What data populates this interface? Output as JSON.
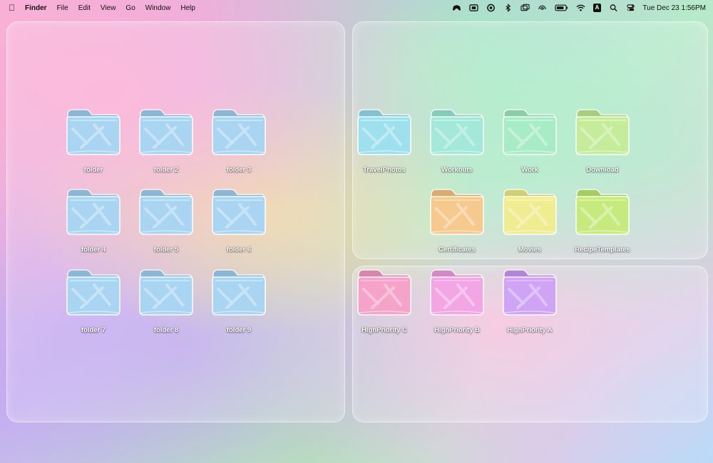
{
  "menubar": {
    "app": "Finder",
    "items": [
      "File",
      "Edit",
      "View",
      "Go",
      "Window",
      "Help"
    ],
    "status_icons": [
      "game-controller-icon",
      "display-icon",
      "chatgpt-icon",
      "bluetooth-icon",
      "screen-mirror-icon",
      "airdrop-icon",
      "battery-icon",
      "wifi-icon"
    ],
    "input_badge": "A",
    "clock": "Tue Dec 23  1:56PM"
  },
  "folders": [
    {
      "name": "folder",
      "color": "#a9d4f2"
    },
    {
      "name": "folder 2",
      "color": "#a9d4f2"
    },
    {
      "name": "folder 3",
      "color": "#a9d4f2"
    },
    {
      "name": "folder 4",
      "color": "#a9d4f2"
    },
    {
      "name": "folder 5",
      "color": "#a9d4f2"
    },
    {
      "name": "folder 6",
      "color": "#a9d4f2"
    },
    {
      "name": "folder 7",
      "color": "#a9d4f2"
    },
    {
      "name": "folder 8",
      "color": "#a9d4f2"
    },
    {
      "name": "folder 9",
      "color": "#a9d4f2"
    },
    {
      "name": "TravelPhotos",
      "color": "#9fe0ef"
    },
    {
      "name": "Workouts",
      "color": "#a3e8d8"
    },
    {
      "name": "Work",
      "color": "#a8ecc6"
    },
    {
      "name": "Download",
      "color": "#c4ec9a"
    },
    {
      "name": "Certificates",
      "color": "#f6c98f"
    },
    {
      "name": "Movies",
      "color": "#f0ec92"
    },
    {
      "name": "RecipeTemplates",
      "color": "#c7ea7e"
    },
    {
      "name": "HighPriority C",
      "color": "#f5a3c8"
    },
    {
      "name": "HighPriority B",
      "color": "#f3a6e4"
    },
    {
      "name": "HighPriority A",
      "color": "#cfa4f5"
    }
  ]
}
